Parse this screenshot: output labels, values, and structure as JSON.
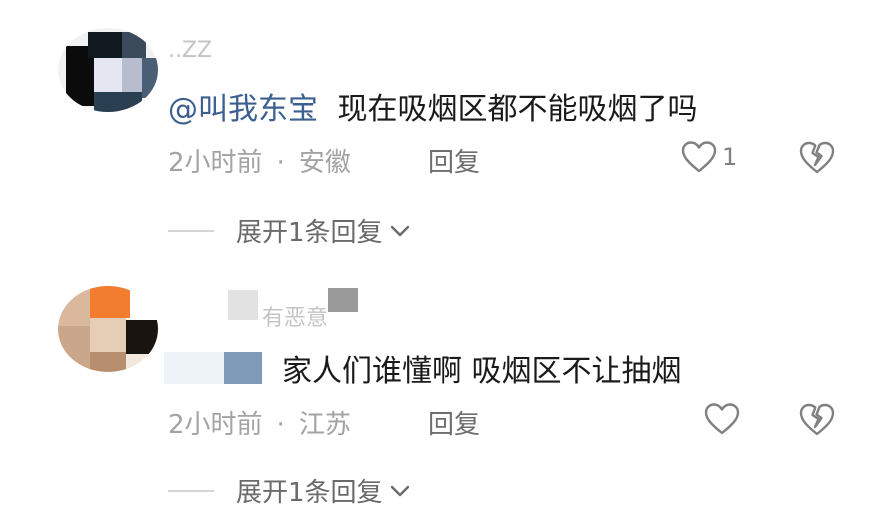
{
  "comments": [
    {
      "username": "..ZZ",
      "mention": "@叫我东宝",
      "text": "现在吸烟区都不能吸烟了吗",
      "time": "2小时前",
      "separator": "·",
      "location": "安徽",
      "reply_label": "回复",
      "like_count": "1",
      "expand_label": "展开1条回复"
    },
    {
      "username": "有恶意",
      "text": "家人们谁懂啊 吸烟区不让抽烟",
      "time": "2小时前",
      "separator": "·",
      "location": "江苏",
      "reply_label": "回复",
      "like_count": "",
      "expand_label": "展开1条回复"
    }
  ],
  "icons": {
    "like": "heart-outline-icon",
    "dislike": "broken-heart-icon",
    "expand": "chevron-down-icon"
  },
  "colors": {
    "mention": "#3b5f8f",
    "text": "#1a1a1a",
    "meta": "#a3a3a3",
    "icon": "#808080"
  }
}
